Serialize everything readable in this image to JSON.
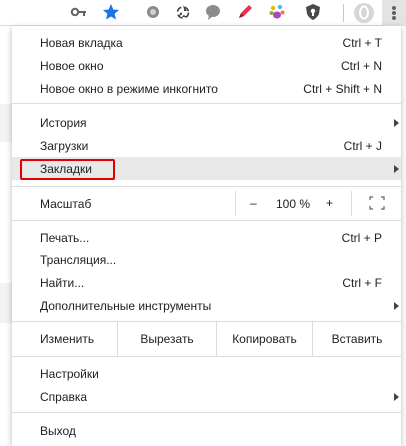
{
  "menu": {
    "new_tab": {
      "label": "Новая вкладка",
      "shortcut": "Ctrl + T"
    },
    "new_window": {
      "label": "Новое окно",
      "shortcut": "Ctrl + N"
    },
    "incognito": {
      "label": "Новое окно в режиме инкогнито",
      "shortcut": "Ctrl + Shift + N"
    },
    "history": {
      "label": "История"
    },
    "downloads": {
      "label": "Загрузки",
      "shortcut": "Ctrl + J"
    },
    "bookmarks": {
      "label": "Закладки"
    },
    "zoom": {
      "label": "Масштаб",
      "minus": "–",
      "value": "100 %",
      "plus": "+"
    },
    "print": {
      "label": "Печать...",
      "shortcut": "Ctrl + P"
    },
    "cast": {
      "label": "Трансляция..."
    },
    "find": {
      "label": "Найти...",
      "shortcut": "Ctrl + F"
    },
    "more_tools": {
      "label": "Дополнительные инструменты"
    },
    "edit": {
      "label": "Изменить",
      "cut": "Вырезать",
      "copy": "Копировать",
      "paste": "Вставить"
    },
    "settings": {
      "label": "Настройки"
    },
    "help": {
      "label": "Справка"
    },
    "exit": {
      "label": "Выход"
    }
  },
  "toolbar_icons": [
    "key-icon",
    "bookmark-star-icon",
    "extension-circle-icon",
    "recycle-extension-icon",
    "chat-bubble-extension-icon",
    "pen-extension-icon",
    "paw-extension-icon",
    "shield-extension-icon",
    "profile-avatar-icon",
    "chrome-menu-icon"
  ],
  "colors": {
    "accent": "#1a73e8",
    "highlight": "#e00000",
    "hover_row": "#e8e8e8"
  }
}
